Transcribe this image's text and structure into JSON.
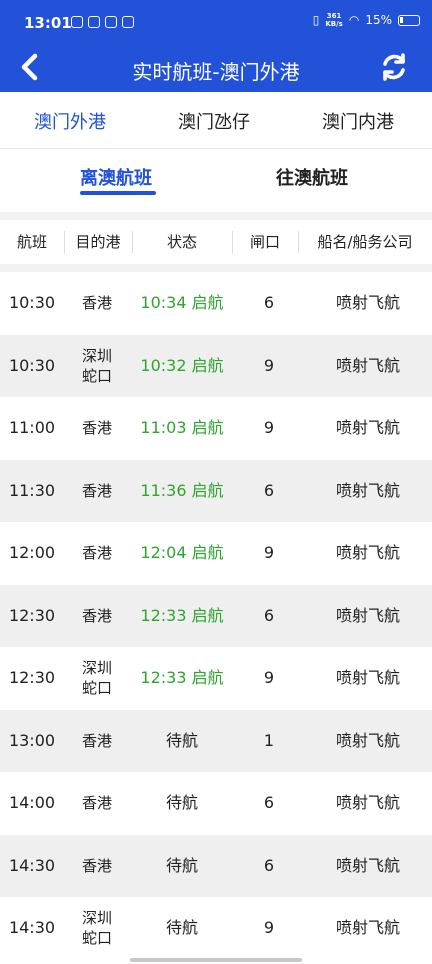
{
  "status_bar": {
    "time": "13:01",
    "net_speed_value": "361",
    "net_speed_unit": "KB/s",
    "battery": "15%"
  },
  "header": {
    "title": "实时航班-澳门外港"
  },
  "port_tabs": [
    {
      "label": "澳门外港",
      "active": true
    },
    {
      "label": "澳门氹仔",
      "active": false
    },
    {
      "label": "澳门内港",
      "active": false
    }
  ],
  "direction_tabs": [
    {
      "label": "离澳航班",
      "active": true
    },
    {
      "label": "往澳航班",
      "active": false
    }
  ],
  "table": {
    "headers": [
      "航班",
      "目的港",
      "状态",
      "闸口",
      "船名/船务公司"
    ],
    "rows": [
      {
        "time": "10:30",
        "dest": "香港",
        "status": "10:34 启航",
        "gate": "6",
        "ship": "喷射飞航"
      },
      {
        "time": "10:30",
        "dest": "深圳蛇口",
        "status": "10:32 启航",
        "gate": "9",
        "ship": "喷射飞航"
      },
      {
        "time": "11:00",
        "dest": "香港",
        "status": "11:03 启航",
        "gate": "9",
        "ship": "喷射飞航"
      },
      {
        "time": "11:30",
        "dest": "香港",
        "status": "11:36 启航",
        "gate": "6",
        "ship": "喷射飞航"
      },
      {
        "time": "12:00",
        "dest": "香港",
        "status": "12:04 启航",
        "gate": "9",
        "ship": "喷射飞航"
      },
      {
        "time": "12:30",
        "dest": "香港",
        "status": "12:33 启航",
        "gate": "6",
        "ship": "喷射飞航"
      },
      {
        "time": "12:30",
        "dest": "深圳蛇口",
        "status": "12:33 启航",
        "gate": "9",
        "ship": "喷射飞航"
      },
      {
        "time": "13:00",
        "dest": "香港",
        "status": "待航",
        "gate": "1",
        "ship": "喷射飞航"
      },
      {
        "time": "14:00",
        "dest": "香港",
        "status": "待航",
        "gate": "6",
        "ship": "喷射飞航"
      },
      {
        "time": "14:30",
        "dest": "香港",
        "status": "待航",
        "gate": "6",
        "ship": "喷射飞航"
      },
      {
        "time": "14:30",
        "dest": "深圳蛇口",
        "status": "待航",
        "gate": "9",
        "ship": "喷射飞航"
      }
    ]
  },
  "colors": {
    "brand": "#2152d8",
    "departed": "#2ea52e",
    "row_alt": "#efefef"
  },
  "icons": [
    "back-arrow-icon",
    "refresh-icon"
  ]
}
